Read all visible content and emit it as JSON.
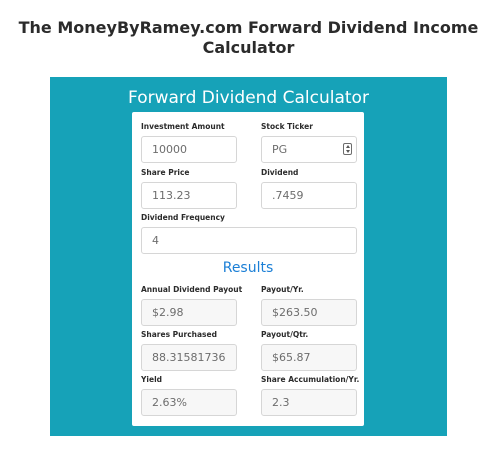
{
  "page": {
    "title": "The MoneyByRamey.com Forward Dividend Income Calculator"
  },
  "calculator": {
    "title": "Forward Dividend Calculator",
    "inputs": {
      "investment_amount": {
        "label": "Investment Amount",
        "value": "10000"
      },
      "stock_ticker": {
        "label": "Stock Ticker",
        "value": "PG"
      },
      "share_price": {
        "label": "Share Price",
        "value": "113.23"
      },
      "dividend": {
        "label": "Dividend",
        "value": ".7459"
      },
      "dividend_frequency": {
        "label": "Dividend Frequency",
        "value": "4"
      }
    },
    "results": {
      "heading": "Results",
      "annual_dividend_payout": {
        "label": "Annual Dividend Payout",
        "value": "$2.98"
      },
      "payout_per_year": {
        "label": "Payout/Yr.",
        "value": "$263.50"
      },
      "shares_purchased": {
        "label": "Shares Purchased",
        "value": "88.3158173628"
      },
      "payout_per_quarter": {
        "label": "Payout/Qtr.",
        "value": "$65.87"
      },
      "yield": {
        "label": "Yield",
        "value": "2.63%"
      },
      "share_accumulation": {
        "label": "Share Accumulation/Yr.",
        "value": "2.3"
      }
    }
  },
  "colors": {
    "panel_background": "#16a2b8",
    "results_heading": "#1b7fd6",
    "title_text": "#2b2b2b"
  },
  "icons": {
    "ticker_spinner": "spinner-arrows-icon"
  }
}
